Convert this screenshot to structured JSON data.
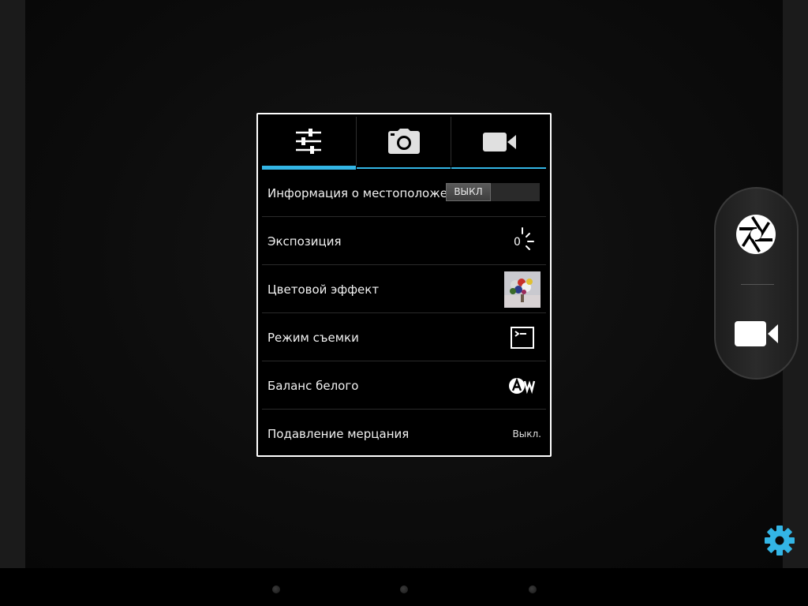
{
  "settings": {
    "tabs": [
      {
        "icon": "sliders-icon",
        "active": true
      },
      {
        "icon": "camera-icon",
        "active": false
      },
      {
        "icon": "video-camera-icon",
        "active": false
      }
    ],
    "rows": [
      {
        "label": "Информация о местоположении",
        "value": "ВЫКЛ",
        "type": "toggle"
      },
      {
        "label": "Экспозиция",
        "value": "0",
        "type": "icon",
        "icon": "exposure-icon"
      },
      {
        "label": "Цветовой эффект",
        "type": "image",
        "icon": "flowers-thumbnail"
      },
      {
        "label": "Режим съемки",
        "type": "icon",
        "icon": "scene-mode-icon"
      },
      {
        "label": "Баланс белого",
        "type": "icon",
        "icon": "auto-white-balance-icon"
      },
      {
        "label": "Подавление мерцания",
        "value": "Выкл.",
        "type": "text"
      }
    ]
  },
  "mode_switcher": {
    "modes": [
      {
        "icon": "shutter-icon",
        "active": true
      },
      {
        "icon": "video-camera-icon",
        "active": false
      }
    ]
  },
  "colors": {
    "accent": "#33b5e5",
    "background": "#000000"
  }
}
